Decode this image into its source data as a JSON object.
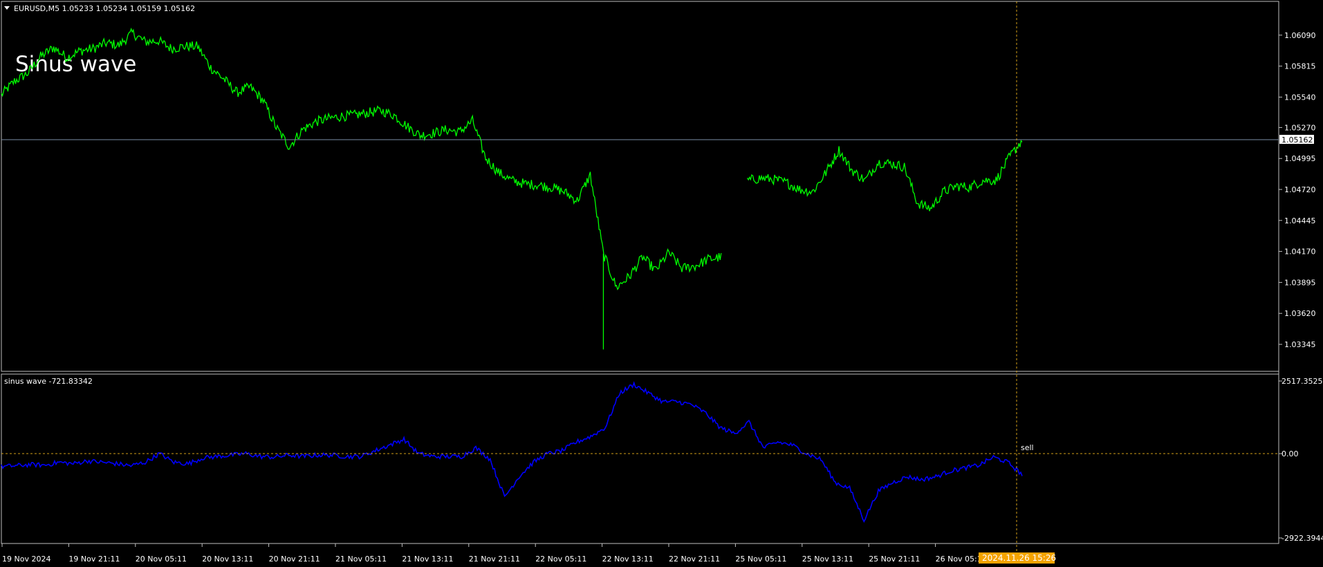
{
  "colors": {
    "background": "#000000",
    "price_line": "#00ff00",
    "indicator_line": "#0000ff",
    "frame": "#c0c0c0",
    "bid_line": "#7a8ea6",
    "crosshair": "#d4a017",
    "zero_line": "#d4a017",
    "time_badge_bg": "#f5a300",
    "text": "#ffffff"
  },
  "header": {
    "symbol_label": "EURUSD,M5  1.05233 1.05234 1.05159 1.05162",
    "menu_icon": "triangle-down-icon",
    "watermark": "Sinus wave"
  },
  "indicator": {
    "label": "sinus wave -721.83342",
    "signal_label": "sell"
  },
  "current_price_label": "1.05162",
  "time_badge": "2024.11.26 15:26",
  "chart_data": [
    {
      "type": "line",
      "name": "price",
      "ylim": [
        1.0321,
        1.0623
      ],
      "yticks": [
        "1.06090",
        "1.05815",
        "1.05540",
        "1.05270",
        "1.04995",
        "1.04720",
        "1.04445",
        "1.04170",
        "1.03895",
        "1.03620",
        "1.03345"
      ],
      "current_value": 1.05162,
      "series": [
        {
          "values": [
            1.0556,
            1.0568,
            1.0575,
            1.059,
            1.0598,
            1.0589,
            1.0595,
            1.0597,
            1.0602,
            1.06,
            1.0611,
            1.0603,
            1.0604,
            1.0597,
            1.0599,
            1.0599,
            1.058,
            1.057,
            1.0558,
            1.0563,
            1.0551,
            1.0527,
            1.051,
            1.0525,
            1.0532,
            1.0535,
            1.0537,
            1.0538,
            1.054,
            1.0542,
            1.0538,
            1.0528,
            1.052,
            1.0522,
            1.0525,
            1.0523,
            1.0533,
            1.05,
            1.0487,
            1.048,
            1.0477,
            1.0476,
            1.0474,
            1.047,
            1.0462,
            1.0485,
            1.0415,
            1.0385,
            1.0395,
            1.0412,
            1.04,
            1.0416,
            1.0402,
            1.0404,
            1.041,
            1.0412,
            null,
            1.048,
            1.0482,
            1.0481,
            1.0478,
            1.0472,
            1.047,
            1.0487,
            1.0507,
            1.0489,
            1.048,
            1.0496,
            1.0495,
            1.0492,
            1.046,
            1.0455,
            1.047,
            1.0475,
            1.0474,
            1.048,
            1.048,
            1.05,
            1.0516
          ]
        }
      ]
    },
    {
      "type": "line",
      "name": "sinus wave",
      "ylim": [
        -2922.3944,
        2517.3525
      ],
      "yticks": [
        "2517.3525",
        "0.00",
        "-2922.3944"
      ],
      "zero_line": 0,
      "series": [
        {
          "values": [
            -450,
            -420,
            -380,
            -400,
            -300,
            -350,
            -250,
            -300,
            -350,
            -420,
            -300,
            0,
            -300,
            -350,
            -150,
            -100,
            -50,
            0,
            -100,
            -120,
            -50,
            -100,
            -50,
            -50,
            -100,
            -100,
            100,
            300,
            500,
            0,
            -100,
            -100,
            -100,
            200,
            -200,
            -1500,
            -800,
            -300,
            0,
            100,
            400,
            600,
            900,
            2100,
            2400,
            2100,
            1800,
            1800,
            1700,
            1400,
            900,
            700,
            1100,
            200,
            400,
            300,
            0,
            -200,
            -1000,
            -1200,
            -2300,
            -1300,
            -1000,
            -800,
            -900,
            -800,
            -600,
            -500,
            -400,
            -120,
            -300,
            -721.83
          ]
        }
      ]
    }
  ],
  "x_axis": {
    "ticks": [
      "19 Nov 2024",
      "19 Nov 21:11",
      "20 Nov 05:11",
      "20 Nov 13:11",
      "20 Nov 21:11",
      "21 Nov 05:11",
      "21 Nov 13:11",
      "21 Nov 21:11",
      "22 Nov 05:11",
      "22 Nov 13:11",
      "22 Nov 21:11",
      "25 Nov 05:11",
      "25 Nov 13:11",
      "25 Nov 21:11",
      "26 Nov 05:11"
    ]
  }
}
